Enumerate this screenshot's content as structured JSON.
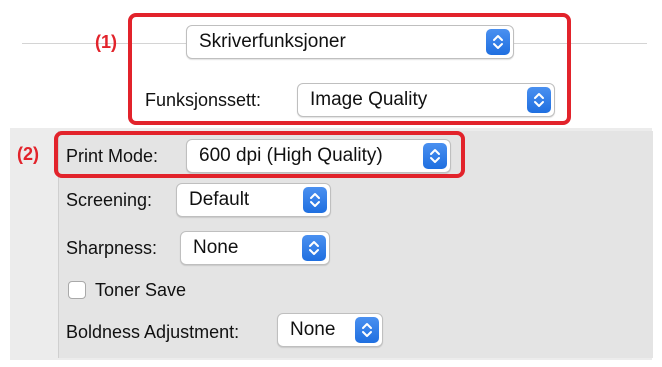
{
  "colors": {
    "callout_red": "#e2232b",
    "stepper_blue": "#2c7be5"
  },
  "callouts": {
    "one": "(1)",
    "two": "(2)"
  },
  "top": {
    "preset_popup_value": "Skriverfunksjoner",
    "feature_set_label": "Funksjonssett:",
    "feature_set_value": "Image Quality"
  },
  "settings": {
    "print_mode_label": "Print Mode:",
    "print_mode_value": "600 dpi (High Quality)",
    "screening_label": "Screening:",
    "screening_value": "Default",
    "sharpness_label": "Sharpness:",
    "sharpness_value": "None",
    "toner_save_label": "Toner Save",
    "toner_save_checked": false,
    "boldness_label": "Boldness Adjustment:",
    "boldness_value": "None"
  },
  "icons": {
    "stepper": "updown-chevron-icon",
    "checkbox": "checkbox-icon"
  }
}
